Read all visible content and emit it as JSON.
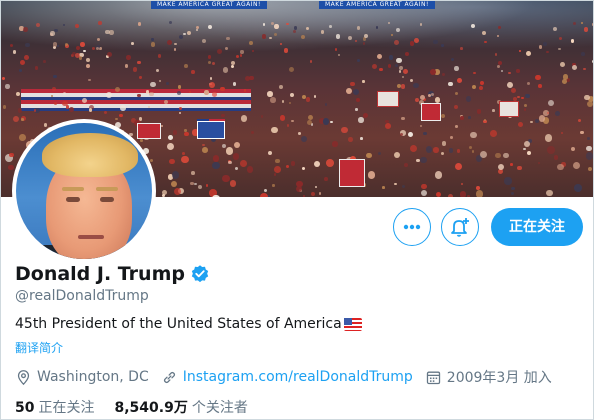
{
  "banner": {
    "sign_left": "MAKE AMERICA GREAT AGAIN!",
    "sign_right": "MAKE AMERICA GREAT AGAIN!",
    "description_color": "#6b3a34"
  },
  "profile": {
    "name": "Donald J. Trump",
    "verified": true,
    "handle": "@realDonaldTrump",
    "bio": "45th President of the United States of America",
    "bio_emoji": "us-flag",
    "translate_label": "翻译简介",
    "location": "Washington, DC",
    "website": "Instagram.com/realDonaldTrump",
    "joined": "2009年3月 加入"
  },
  "actions": {
    "more_icon": "ellipsis-icon",
    "notify_icon": "bell-plus-icon",
    "follow_label": "正在关注"
  },
  "stats": {
    "following_count": "50",
    "following_label": "正在关注",
    "followers_count": "8,540.9万",
    "followers_label": "个关注者"
  },
  "colors": {
    "accent": "#1da1f2",
    "text": "#14171a",
    "secondary": "#657786"
  }
}
